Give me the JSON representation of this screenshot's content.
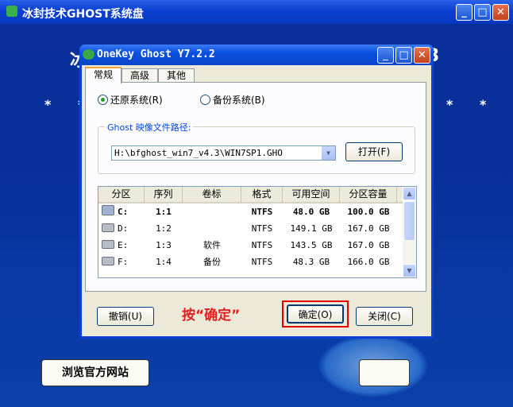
{
  "bg_window": {
    "title": "冰封技术GHOST系统盘",
    "min": "_",
    "max": "□",
    "close": "✕",
    "stars_left": "* *",
    "stars_right": "* *",
    "partial_left": "冰",
    "partial_right": "3",
    "site_button": "浏览官方网站"
  },
  "dialog": {
    "title": "OneKey Ghost Y7.2.2",
    "min": "_",
    "max": "□",
    "close": "✕",
    "tabs": [
      "常规",
      "高级",
      "其他"
    ],
    "radio_restore": "还原系统(R)",
    "radio_backup": "备份系统(B)",
    "group_label": "Ghost 映像文件路径:",
    "path_value": "H:\\bfghost_win7_v4.3\\WIN7SP1.GHO",
    "open_button": "打开(F)",
    "columns": [
      "分区",
      "序列",
      "卷标",
      "格式",
      "可用空间",
      "分区容量"
    ],
    "rows": [
      {
        "part": "C:",
        "seq": "1:1",
        "label": "",
        "fmt": "NTFS",
        "free": "48.0 GB",
        "size": "100.0 GB"
      },
      {
        "part": "D:",
        "seq": "1:2",
        "label": "",
        "fmt": "NTFS",
        "free": "149.1 GB",
        "size": "167.0 GB"
      },
      {
        "part": "E:",
        "seq": "1:3",
        "label": "软件",
        "fmt": "NTFS",
        "free": "143.5 GB",
        "size": "167.0 GB"
      },
      {
        "part": "F:",
        "seq": "1:4",
        "label": "备份",
        "fmt": "NTFS",
        "free": "48.3 GB",
        "size": "166.0 GB"
      }
    ],
    "cancel_button": "撤销(U)",
    "hint": "按“确定”",
    "ok_button": "确定(O)",
    "close_button": "关闭(C)"
  },
  "colors": {
    "hint": "#e02020",
    "highlight": "#e00000",
    "accent": "#0a42d6"
  }
}
